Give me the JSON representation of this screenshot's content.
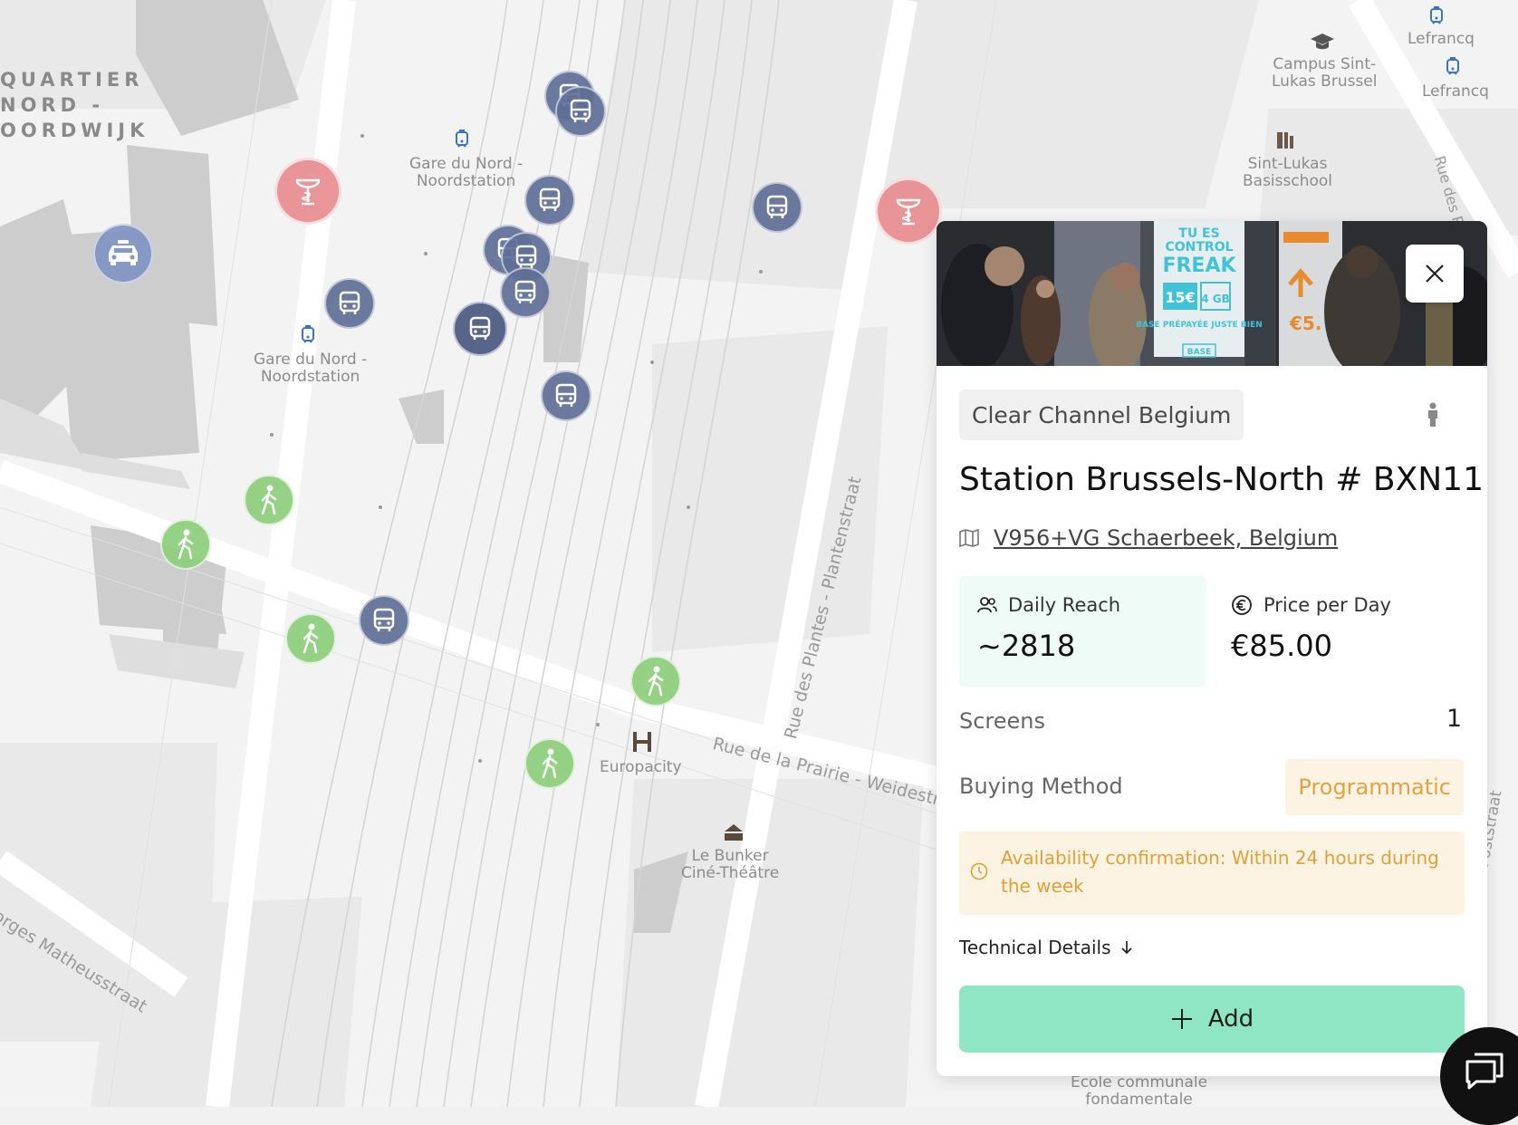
{
  "map": {
    "district": "QUARTIER\nNORD -\nOORDWIJK",
    "labels": {
      "gare_nord_1": "Gare du Nord -\nNoordstation",
      "gare_nord_2": "Gare du Nord -\nNoordstation",
      "campus": "Campus Sint-\nLukas Brussel",
      "lefrancq_1": "Lefrancq",
      "lefrancq_2": "Lefrancq",
      "sint_lukas": "Sint-Lukas\nBasisschool",
      "europacity": "Europacity",
      "bunker": "Le Bunker\nCiné-Théâtre",
      "ecole": "École communale\nfondamentale"
    },
    "streets": {
      "plantes": "Rue des Plantes - Plantenstraat",
      "prairie": "Rue de la Prairie - Weidestraat",
      "matheus": "orges Matheusstraat",
      "palais": "Rue des Palais",
      "poststraat": "rue - Poststraat"
    }
  },
  "card": {
    "vendor": "Clear Channel Belgium",
    "title": "Station Brussels-North # BXN11",
    "address": "V956+VG Schaerbeek, Belgium",
    "daily_reach_label": "Daily Reach",
    "daily_reach_value": "~2818",
    "price_label": "Price per Day",
    "price_value": "€85.00",
    "screens_label": "Screens",
    "screens_value": "1",
    "buying_label": "Buying Method",
    "buying_value": "Programmatic",
    "notice": "Availability confirmation: Within 24 hours during the week",
    "technical_details": "Technical Details",
    "add_label": "Add",
    "photo_text": {
      "poster_line1": "TU ES",
      "poster_line2": "CONTROL",
      "poster_line3": "FREAK",
      "poster_price": "15€",
      "poster_gb": "4\nGB",
      "poster_sub": "BASE PRÉPAYÉE\nJUSTE BIEN",
      "poster_brand": "BASE",
      "right_price": "€5."
    }
  },
  "colors": {
    "accent_green": "#8fe6c4",
    "warning_orange": "#e2a038",
    "bus_marker": "#5f6f96",
    "pharmacy_marker": "#e88a8c",
    "walk_marker": "#8fd07f"
  }
}
